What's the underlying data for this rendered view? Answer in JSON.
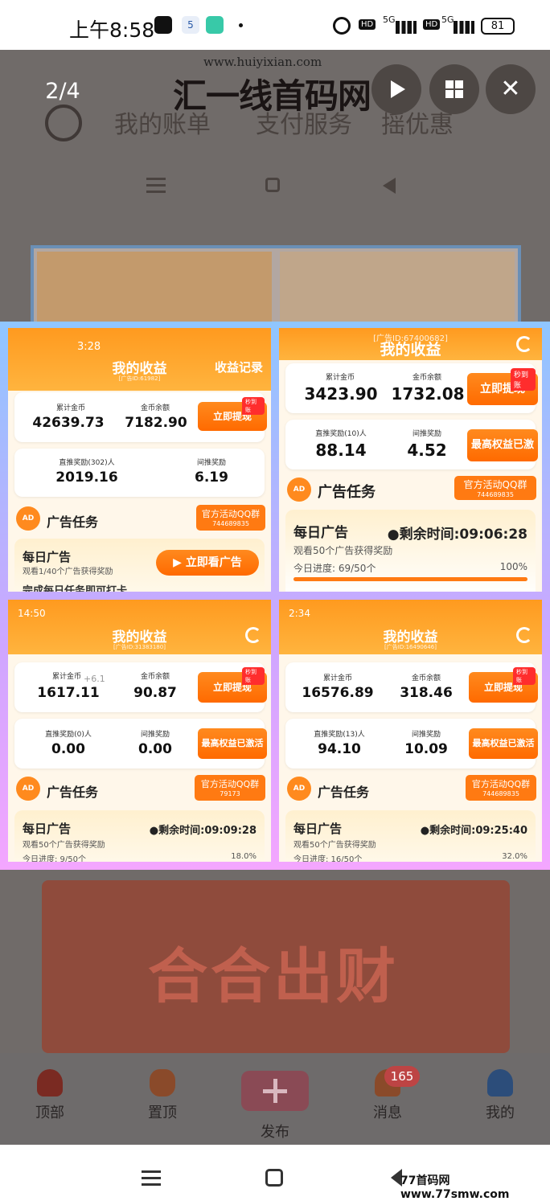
{
  "status_bar": {
    "time": "上午8:58",
    "battery": "81",
    "sig1": "5G",
    "sig2": "5G",
    "hd1": "HD",
    "hd2": "HD",
    "app_badge": "5"
  },
  "viewer": {
    "counter": "2/4"
  },
  "watermark": {
    "url": "www.huiyixian.com",
    "text": "汇一线首码网"
  },
  "background": {
    "tabs": [
      "我的账单",
      "支付服务",
      "摇优惠"
    ]
  },
  "panels": {
    "p1": {
      "time": "3:28",
      "title": "我的收益",
      "record": "收益记录",
      "id_line": "[广告ID:61982]",
      "total_label": "累计金币",
      "total": "42639.73",
      "balance_label": "金币余额",
      "balance": "7182.90",
      "withdraw": "立即提现",
      "tag": "秒到账",
      "direct_label": "直推奖励(302)人",
      "direct": "2019.16",
      "indirect_label": "间推奖励",
      "indirect": "6.19",
      "ad_icon": "AD",
      "ad_title": "广告任务",
      "qq_a": "官方活动QQ群",
      "qq_b": "744689835",
      "daily": "每日广告",
      "daily_sub": "观看1/40个广告获得奖励",
      "watch_btn": "立即看广告",
      "cut": "完成每日任务即可打卡"
    },
    "p2": {
      "id_line": "[广告ID:67400682]",
      "title": "我的收益",
      "total_label": "累计金币",
      "total": "3423.90",
      "balance_label": "金币余额",
      "balance": "1732.08",
      "withdraw": "立即提现",
      "tag": "秒到账",
      "direct_label": "直推奖励(10)人",
      "direct": "88.14",
      "indirect_label": "间推奖励",
      "indirect": "4.52",
      "max": "最高权益已激",
      "ad_icon": "AD",
      "ad_title": "广告任务",
      "qq_a": "官方活动QQ群",
      "qq_b": "744689835",
      "daily": "每日广告",
      "remain": "●剩余时间:09:06:28",
      "daily_sub": "观看50个广告获得奖励",
      "progress_label": "今日进度: 69/50个",
      "progress_pct": "100%",
      "progress": 1.0
    },
    "p3": {
      "time": "14:50",
      "title": "我的收益",
      "id_line": "[广告ID:31383180]",
      "total_label": "累计金币",
      "plus": "+6.1",
      "total": "1617.11",
      "balance_label": "金币余额",
      "balance": "90.87",
      "withdraw": "立即提现",
      "tag": "秒到账",
      "direct_label": "直推奖励(0)人",
      "direct": "0.00",
      "indirect_label": "间推奖励",
      "indirect": "0.00",
      "max": "最高权益已激活",
      "ad_icon": "AD",
      "ad_title": "广告任务",
      "qq_a": "官方活动QQ群",
      "qq_b": "79173",
      "daily": "每日广告",
      "remain": "●剩余时间:09:09:28",
      "daily_sub": "观看50个广告获得奖励",
      "progress_label": "今日进度: 9/50个",
      "progress_pct": "18.0%",
      "progress": 0.18
    },
    "p4": {
      "time": "2:34",
      "title": "我的收益",
      "id_line": "[广告ID:16490646]",
      "total_label": "累计金币",
      "total": "16576.89",
      "balance_label": "金币余额",
      "balance": "318.46",
      "withdraw": "立即提现",
      "tag": "秒到账",
      "direct_label": "直推奖励(13)人",
      "direct": "94.10",
      "indirect_label": "间推奖励",
      "indirect": "10.09",
      "max": "最高权益已激活",
      "ad_icon": "AD",
      "ad_title": "广告任务",
      "qq_a": "官方活动QQ群",
      "qq_b": "744689835",
      "daily": "每日广告",
      "remain": "●剩余时间:09:25:40",
      "daily_sub": "观看50个广告获得奖励",
      "progress_label": "今日进度: 16/50个",
      "progress_pct": "32.0%",
      "progress": 0.32
    }
  },
  "poster": {
    "title": "合合出财"
  },
  "bottom_nav": {
    "items": [
      "顶部",
      "置顶",
      "发布",
      "消息",
      "我的"
    ],
    "badge": "165"
  },
  "footer": {
    "text": "77首码网 www.77smw.com"
  }
}
